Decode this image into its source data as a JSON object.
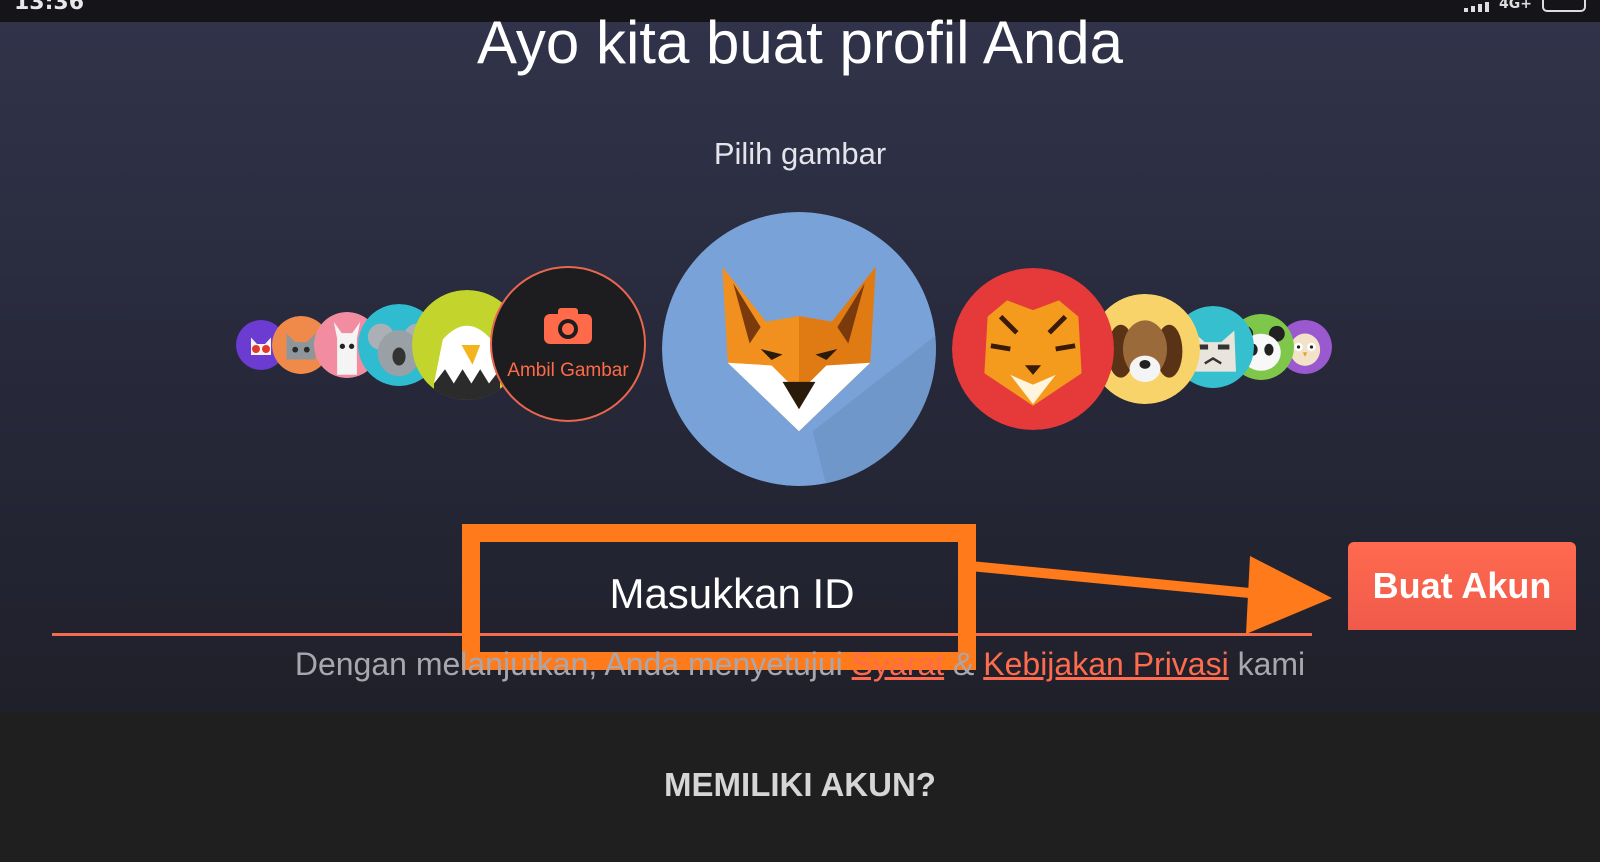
{
  "status_bar": {
    "time": "13:36",
    "network": "4G+"
  },
  "page": {
    "title": "Ayo kita buat profil Anda",
    "pick_label": "Pilih gambar"
  },
  "avatars": {
    "camera_label": "Ambil Gambar",
    "selected": "fox-avatar",
    "left": [
      "cat-sunglasses-avatar",
      "grey-cat-avatar",
      "llama-avatar",
      "koala-avatar",
      "eagle-avatar"
    ],
    "right": [
      "tiger-avatar",
      "beagle-avatar",
      "grumpy-cat-avatar",
      "panda-avatar",
      "owl-avatar"
    ]
  },
  "id_input": {
    "placeholder": "Masukkan ID",
    "value": ""
  },
  "create_button": {
    "label": "Buat Akun"
  },
  "terms": {
    "prefix": "Dengan melanjutkan, Anda menyetujui ",
    "terms_link": "Syarat",
    "and": " & ",
    "privacy_link": "Kebijakan Privasi",
    "suffix": " kami"
  },
  "footer": {
    "have_account": "MEMILIKI AKUN?"
  },
  "colors": {
    "accent": "#f26c4f",
    "highlight": "#ff7a1a",
    "background": "#2a2b3d"
  }
}
